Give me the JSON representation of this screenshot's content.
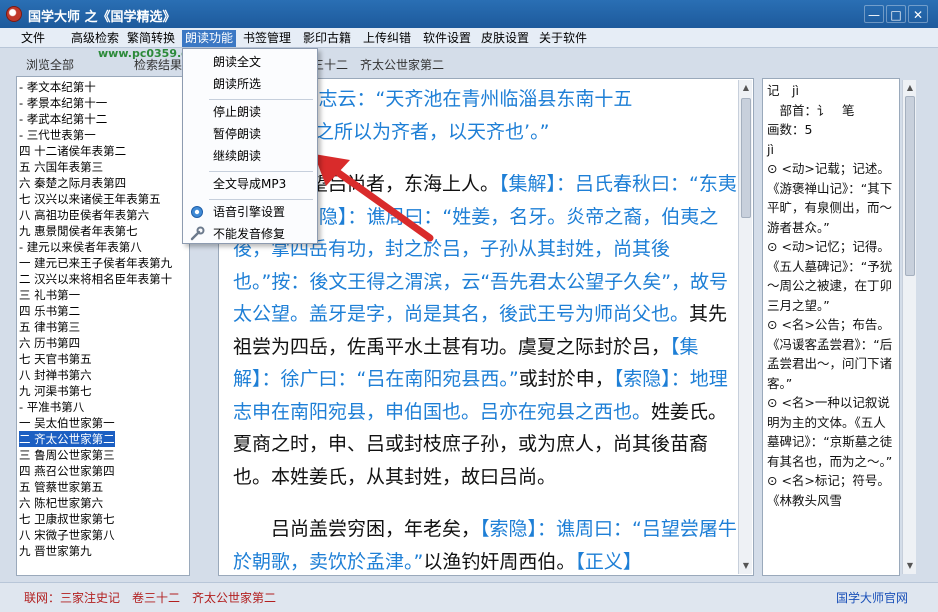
{
  "window": {
    "title": "国学大师 之《国学精选》",
    "controls": {
      "minimize": "—",
      "maximize": "□",
      "close": "✕"
    }
  },
  "menubar": [
    {
      "label": "文件"
    },
    {
      "label": "高级检索"
    },
    {
      "label": "繁简转换"
    },
    {
      "label": "朗读功能",
      "active": true
    },
    {
      "label": "书签管理"
    },
    {
      "label": "影印古籍"
    },
    {
      "label": "上传纠错"
    },
    {
      "label": "软件设置"
    },
    {
      "label": "皮肤设置"
    },
    {
      "label": "关于软件"
    }
  ],
  "watermark": "www.pc0359.cn",
  "left_tabs": {
    "browse": "浏览全部",
    "search": "检索结果"
  },
  "breadcrumb": "卷三十二　齐太公世家第二",
  "tree": [
    "- 孝文本纪第十",
    "- 孝景本纪第十一",
    "- 孝武本纪第十二",
    "- 三代世表第一",
    "四 十二诸侯年表第二",
    "五 六国年表第三",
    "六 秦楚之际月表第四",
    "七 汉兴以来诸侯王年表第五",
    "八 高祖功臣侯者年表第六",
    "九 惠景閒侯者年表第七",
    "- 建元以来侯者年表第八",
    "一 建元已来王子侯者年表第九",
    "二 汉兴以来将相名臣年表第十",
    "三 礼书第一",
    "四 乐书第二",
    "五 律书第三",
    "六 历书第四",
    "七 天官书第五",
    "八 封禅书第六",
    "九 河渠书第七",
    "- 平准书第八",
    "一 吴太伯世家第一",
    "二 齐太公世家第二",
    "三 鲁周公世家第三",
    "四 燕召公世家第四",
    "五 管蔡世家第五",
    "六 陈杞世家第六",
    "七 卫康叔世家第七",
    "八 宋微子世家第八",
    "九 晋世家第九"
  ],
  "tree_selected_index": 22,
  "dropdown": {
    "items": [
      {
        "label": "朗读全文"
      },
      {
        "label": "朗读所选"
      },
      {
        "sep": true
      },
      {
        "label": "停止朗读"
      },
      {
        "label": "暂停朗读"
      },
      {
        "label": "继续朗读"
      },
      {
        "sep": true
      },
      {
        "label": "全文导成MP3"
      },
      {
        "sep": true
      },
      {
        "label": "语音引擎设置",
        "icon": "gear-icon"
      },
      {
        "label": "不能发音修复",
        "icon": "wrench-icon"
      }
    ]
  },
  "main_text": {
    "line1": "文】：括地志云：“天齐池在青州临淄县东南十五",
    "line2": "里，",
    "line2b": "云‘齐之所以为齐者，以天齐也’。”",
    "p2": [
      {
        "t": "太公望吕尚者，东海上人。",
        "c": false
      },
      {
        "t": "【集解】：吕氏春秋曰：",
        "c": true
      },
      {
        "t": "“东夷之士。”",
        "c": true
      },
      {
        "t": "【索隐】：谯周曰：“姓姜，名牙。炎帝之裔，伯夷之後，掌四岳有功，封之於吕，子孙从其封姓，尚其後也。”按：後文王得之渭滨，云“吾先君太公望子久矣”，故号太公望。盖牙是字，尚是其名，後武王号为师尚父也。",
        "c": true
      },
      {
        "t": "其先祖尝为四岳，佐禹平水土甚有功。虞夏之际封於吕，",
        "c": false
      },
      {
        "t": "【集解】：徐广曰：“吕在南阳宛县西。”",
        "c": true
      },
      {
        "t": "或封於申，",
        "c": false
      },
      {
        "t": "【索隐】：地理志申在南阳宛县，申伯国也。吕亦在宛县之西也。",
        "c": true
      },
      {
        "t": "姓姜氏。夏商之时，申、吕或封枝庶子孙，或为庶人，尚其後苗裔也。本姓姜氏，从其封姓，故曰吕尚。",
        "c": false
      }
    ],
    "p3": [
      {
        "t": "吕尚盖尝穷困，年老矣，",
        "c": false
      },
      {
        "t": "【索隐】：谯周曰：“吕望尝",
        "c": true
      },
      {
        "t": "屠牛於朝歌，卖饮於孟津。”",
        "c": true
      },
      {
        "t": "以渔钓奸周西伯。",
        "c": false
      },
      {
        "t": "【正义】",
        "c": true
      }
    ]
  },
  "dictionary": {
    "entry": "记　jì",
    "radical": "　部首：讠　笔",
    "strokes": "画数：5",
    "pinyin": "jì",
    "senses": [
      "⊙ <动>记载；记述。《游褒禅山记》：“其下平旷，有泉侧出，而～游者甚众。”",
      "⊙ <动>记忆；记得。《五人墓碑记》：“予犹～周公之被逮，在丁卯三月之望。”",
      "⊙ <名>公告；布告。《冯谖客孟尝君》：“后孟尝君出～，问门下诸客。”",
      "⊙ <名>一种以记叙说明为主的文体。《五人墓碑记》：“京斯墓之徒有其名也，而为之～。”",
      "⊙ <名>标记；符号。《林教头风雪"
    ]
  },
  "status": {
    "text": "联网：三家注史记　卷三十二　齐太公世家第二",
    "site": "国学大师官网"
  },
  "colors": {
    "titlebar": "#1d5a9c",
    "commentary": "#1e7fd6",
    "selection": "#1c5fc2",
    "status_text": "#b21f1f",
    "annotation_arrow": "#d92b2b"
  }
}
